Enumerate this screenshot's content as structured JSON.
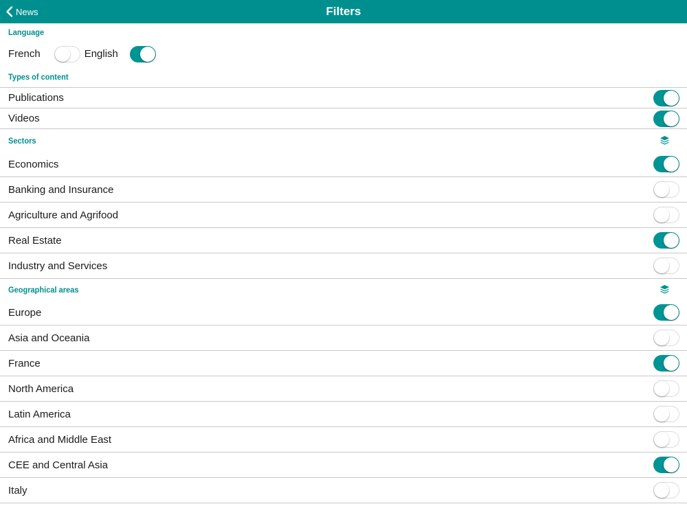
{
  "colors": {
    "accent": "#008f8f",
    "toggle_on": "#009494",
    "divider": "#c8c8c8"
  },
  "navbar": {
    "back_label": "News",
    "back_icon": "chevron-left-icon",
    "title": "Filters"
  },
  "language": {
    "header": "Language",
    "options": [
      {
        "label": "French",
        "on": false
      },
      {
        "label": "English",
        "on": true
      }
    ]
  },
  "content_types": {
    "header": "Types of content",
    "items": [
      {
        "label": "Publications",
        "on": true
      },
      {
        "label": "Videos",
        "on": true
      }
    ]
  },
  "sectors": {
    "header": "Sectors",
    "icon": "layers-icon",
    "items": [
      {
        "label": "Economics",
        "on": true
      },
      {
        "label": "Banking and Insurance",
        "on": false
      },
      {
        "label": "Agriculture and Agrifood",
        "on": false
      },
      {
        "label": "Real Estate",
        "on": true
      },
      {
        "label": "Industry and Services",
        "on": false
      }
    ]
  },
  "geo": {
    "header": "Geographical areas",
    "icon": "layers-icon",
    "items": [
      {
        "label": "Europe",
        "on": true
      },
      {
        "label": "Asia and Oceania",
        "on": false
      },
      {
        "label": "France",
        "on": true
      },
      {
        "label": "North America",
        "on": false
      },
      {
        "label": "Latin America",
        "on": false
      },
      {
        "label": "Africa and Middle East",
        "on": false
      },
      {
        "label": "CEE and Central Asia",
        "on": true
      },
      {
        "label": "Italy",
        "on": false
      }
    ]
  }
}
